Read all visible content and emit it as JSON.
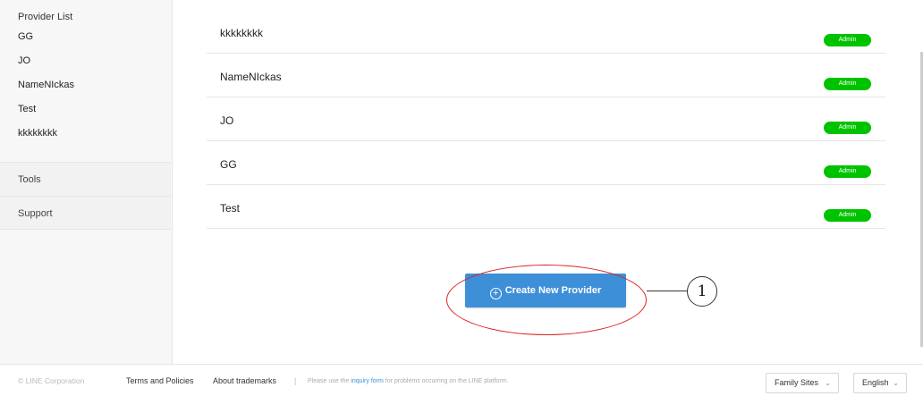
{
  "sidebar": {
    "section_title": "Provider List",
    "providers": [
      "GG",
      "JO",
      "NameNIckas",
      "Test",
      "kkkkkkkk"
    ],
    "nav": {
      "tools": "Tools",
      "support": "Support"
    }
  },
  "providers": [
    {
      "name": "kkkkkkkk",
      "role": "Admin"
    },
    {
      "name": "NameNIckas",
      "role": "Admin"
    },
    {
      "name": "JO",
      "role": "Admin"
    },
    {
      "name": "GG",
      "role": "Admin"
    },
    {
      "name": "Test",
      "role": "Admin"
    }
  ],
  "create_button": {
    "label": "Create New Provider",
    "icon": "plus-circle-icon"
  },
  "annotation": {
    "number": "1",
    "color": "#d9231f"
  },
  "footer": {
    "copyright": "© LINE Corporation",
    "terms": "Terms and Policies",
    "trademarks": "About trademarks",
    "separator": "|",
    "note_prefix": "Please use the ",
    "note_link": "inquiry form",
    "note_suffix": " for problems occurring on the LINE platform.",
    "family_sites": "Family Sites",
    "language": "English"
  },
  "colors": {
    "badge": "#00c300",
    "button": "#3d8fd8",
    "link": "#3d8fd8"
  }
}
